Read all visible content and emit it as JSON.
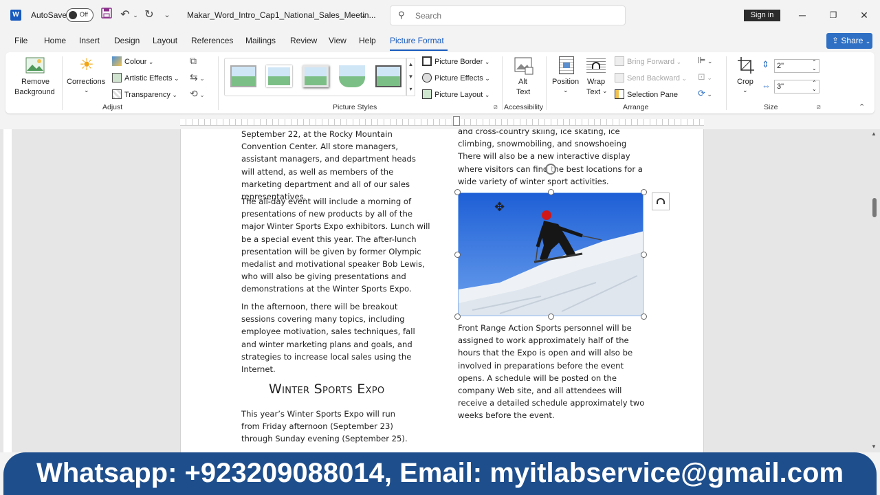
{
  "titlebar": {
    "app_logo": "W",
    "autosave_label": "AutoSave",
    "autosave_state": "Off",
    "doc_title": "Makar_Word_Intro_Cap1_National_Sales_Meetin...",
    "search_placeholder": "Search",
    "signin_label": "Sign in"
  },
  "tabs": [
    "File",
    "Home",
    "Insert",
    "Design",
    "Layout",
    "References",
    "Mailings",
    "Review",
    "View",
    "Help",
    "Picture Format"
  ],
  "active_tab": "Picture Format",
  "share_label": "Share",
  "ribbon": {
    "remove_background": [
      "Remove",
      "Background"
    ],
    "corrections": "Corrections",
    "colour": "Colour",
    "artistic_effects": "Artistic Effects",
    "transparency": "Transparency",
    "adjust_group": "Adjust",
    "picture_styles_group": "Picture Styles",
    "picture_border": "Picture Border",
    "picture_effects": "Picture Effects",
    "picture_layout": "Picture Layout",
    "alt_text": [
      "Alt",
      "Text"
    ],
    "accessibility_group": "Accessibility",
    "position": "Position",
    "wrap_text": [
      "Wrap",
      "Text"
    ],
    "bring_forward": "Bring Forward",
    "send_backward": "Send Backward",
    "selection_pane": "Selection Pane",
    "arrange_group": "Arrange",
    "crop": "Crop",
    "height_value": "2\"",
    "width_value": "3\"",
    "size_group": "Size"
  },
  "document": {
    "col1_paragraphs": [
      "September 22, at the Rocky Mountain Convention Center. All store managers, assistant managers, and department heads will attend, as well as members of the marketing department and all of our sales representatives.",
      "The all-day event will include a morning of presentations of new products by all of the major Winter Sports Expo exhibitors. Lunch will be a special event this year. The after-lunch presentation will be given by former Olympic medalist and motivational speaker Bob Lewis, who will also be giving presentations and demonstrations at the Winter Sports Expo.",
      "In the afternoon, there will be breakout sessions covering many topics, including employee motivation, sales techniques, fall and winter marketing plans and goals, and strategies to increase local sales using the Internet."
    ],
    "heading": "Winter Sports Expo",
    "col1_after_heading": "This year’s Winter Sports Expo will run from Friday afternoon (September 23) through Sunday evening (September 25).",
    "col2_top_lines": [
      "and cross-country skiing, ice skating, ice",
      "climbing, snowmobiling, and snowshoeing",
      "There will also be a new interactive display",
      "where visitors can find the best locations for a",
      "wide variety of winter sport activities."
    ],
    "col2_after_picture": "Front Range Action Sports personnel will be assigned to work approximately half of the hours that the Expo is open and will also be involved in preparations before the event opens. A schedule will be posted on the company Web site, and all attendees will receive a detailed schedule approximately two weeks before the event."
  },
  "banner": "Whatsapp: +923209088014, Email: myitlabservice@gmail.com",
  "colors": {
    "accent": "#185abd",
    "share": "#2f70c4",
    "banner": "#1e4e8c"
  }
}
